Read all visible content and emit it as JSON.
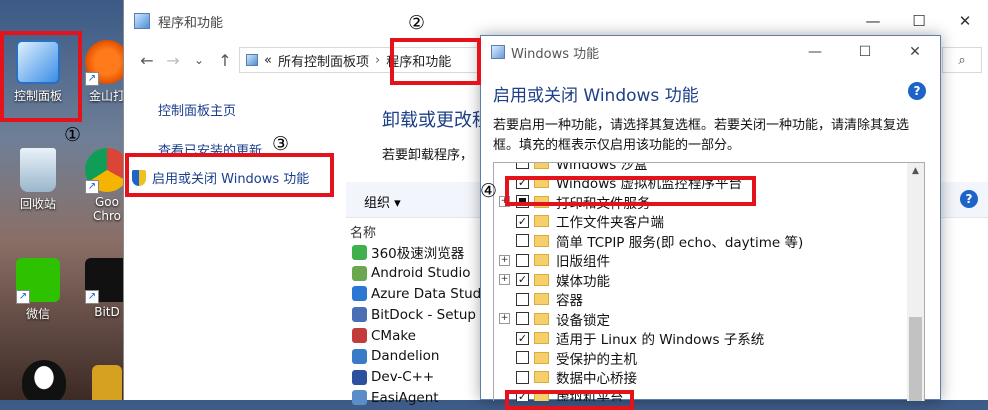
{
  "desktop": {
    "icons": [
      {
        "label": "控制面板"
      },
      {
        "label": "金山打"
      },
      {
        "label": "回收站"
      },
      {
        "label": "Goo Chro"
      },
      {
        "label": "微信"
      },
      {
        "label": "BitD"
      }
    ]
  },
  "annotations": {
    "n1": "①",
    "n2": "②",
    "n3": "③",
    "n4": "④"
  },
  "cp_window": {
    "title": "程序和功能",
    "controls": {
      "minimize": "—",
      "maximize": "☐",
      "close": "✕"
    },
    "nav": {
      "back": "←",
      "forward": "→",
      "dropdown": "⌄",
      "up": "↑"
    },
    "address": {
      "prefix": "«",
      "crumb1": "所有控制面板项",
      "sep": "›",
      "crumb2": "程序和功能"
    },
    "search_icon": "⌕",
    "left_links": [
      "控制面板主页",
      "查看已安装的更新",
      "启用或关闭 Windows 功能"
    ],
    "main_title": "卸载或更改程",
    "main_desc": "若要卸载程序，",
    "toolbar": {
      "organize": "组织 ▾",
      "help": "?"
    },
    "column_name": "名称",
    "programs": [
      {
        "name": "360极速浏览器",
        "color": "#3fb04b"
      },
      {
        "name": "Android Studio",
        "color": "#6aa84f"
      },
      {
        "name": "Azure Data Studi",
        "color": "#2b78d4"
      },
      {
        "name": "BitDock - Setup v",
        "color": "#4a6fb5"
      },
      {
        "name": "CMake",
        "color": "#c43b3b"
      },
      {
        "name": "Dandelion",
        "color": "#3a7bc8"
      },
      {
        "name": "Dev-C++",
        "color": "#2c4f9e"
      },
      {
        "name": "EasiAgent",
        "color": "#5b8ec9"
      }
    ]
  },
  "wf_dialog": {
    "title": "Windows 功能",
    "controls": {
      "minimize": "—",
      "maximize": "☐",
      "close": "✕"
    },
    "heading": "启用或关闭 Windows 功能",
    "help": "?",
    "description": "若要启用一种功能，请选择其复选框。若要关闭一种功能，请清除其复选框。填充的框表示仅启用该功能的一部分。",
    "scroll_up": "▲",
    "features": [
      {
        "label": "Windows 沙盒",
        "state": "unchecked",
        "expandable": false
      },
      {
        "label": "Windows 虚拟机监控程序平台",
        "state": "checked",
        "expandable": false
      },
      {
        "label": "打印和文件服务",
        "state": "partial",
        "expandable": true
      },
      {
        "label": "工作文件夹客户端",
        "state": "checked",
        "expandable": false
      },
      {
        "label": "简单 TCPIP 服务(即 echo、daytime 等)",
        "state": "unchecked",
        "expandable": false
      },
      {
        "label": "旧版组件",
        "state": "unchecked",
        "expandable": true
      },
      {
        "label": "媒体功能",
        "state": "checked",
        "expandable": true
      },
      {
        "label": "容器",
        "state": "unchecked",
        "expandable": false
      },
      {
        "label": "设备锁定",
        "state": "unchecked",
        "expandable": true
      },
      {
        "label": "适用于 Linux 的 Windows 子系统",
        "state": "checked",
        "expandable": false
      },
      {
        "label": "受保护的主机",
        "state": "unchecked",
        "expandable": false
      },
      {
        "label": "数据中心桥接",
        "state": "unchecked",
        "expandable": false
      },
      {
        "label": "虚拟机平台",
        "state": "checked",
        "expandable": false
      }
    ]
  }
}
